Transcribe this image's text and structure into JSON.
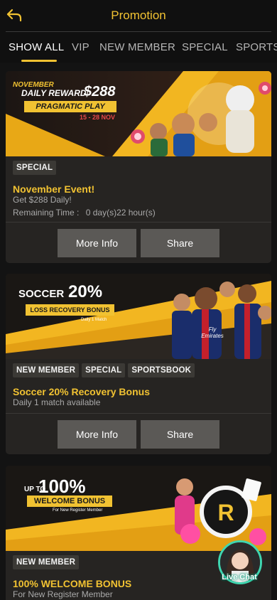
{
  "header": {
    "title": "Promotion"
  },
  "tabs": [
    {
      "label": "SHOW ALL",
      "active": true
    },
    {
      "label": "VIP"
    },
    {
      "label": "NEW MEMBER"
    },
    {
      "label": "SPECIAL"
    },
    {
      "label": "SPORTS"
    }
  ],
  "promotions": [
    {
      "banner": {
        "month": "NOVEMBER",
        "line1": "DAILY REWARD",
        "amount": "$288",
        "badge": "PRAGMATIC PLAY",
        "dates": "15 - 28 NOV"
      },
      "tags": [
        "SPECIAL"
      ],
      "title": "November Event!",
      "subtitle": "Get $288 Daily!",
      "remaining_label": "Remaining Time :",
      "remaining_value": "0 day(s)22 hour(s)",
      "more_info_label": "More Info",
      "share_label": "Share"
    },
    {
      "banner": {
        "word": "SOCCER",
        "percent": "20%",
        "badge": "LOSS RECOVERY BONUS",
        "note": "Daily 1 Match",
        "jersey": "Fly Emirates"
      },
      "tags": [
        "NEW MEMBER",
        "SPECIAL",
        "SPORTSBOOK"
      ],
      "title": "Soccer 20% Recovery Bonus",
      "subtitle": "Daily 1 match available",
      "more_info_label": "More Info",
      "share_label": "Share"
    },
    {
      "banner": {
        "prefix": "UP TO",
        "percent": "100%",
        "badge": "WELCOME BONUS",
        "note": "For New Register Member"
      },
      "tags": [
        "NEW MEMBER"
      ],
      "title": "100% WELCOME BONUS",
      "subtitle": "For New Register Member"
    }
  ],
  "live_chat": {
    "label": "Live Chat"
  },
  "colors": {
    "accent": "#f1c232",
    "background": "#131313",
    "card": "#262422",
    "button": "#5b5956"
  }
}
